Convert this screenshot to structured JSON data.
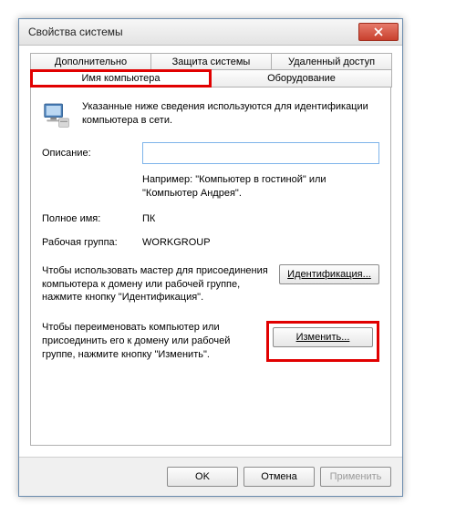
{
  "title": "Свойства системы",
  "tabs_top": [
    "Дополнительно",
    "Защита системы",
    "Удаленный доступ"
  ],
  "tabs_bottom": [
    "Имя компьютера",
    "Оборудование"
  ],
  "active_tab": "Имя компьютера",
  "intro": "Указанные ниже сведения используются для идентификации компьютера в сети.",
  "description": {
    "label": "Описание:",
    "value": ""
  },
  "example": "Например: \"Компьютер в гостиной\" или \"Компьютер Андрея\".",
  "fullname": {
    "label": "Полное имя:",
    "value": "ПК"
  },
  "workgroup": {
    "label": "Рабочая группа:",
    "value": "WORKGROUP"
  },
  "ident_block": {
    "text": "Чтобы использовать мастер для присоединения компьютера к домену или рабочей группе, нажмите кнопку \"Идентификация\".",
    "button": "Идентификация..."
  },
  "change_block": {
    "text": "Чтобы переименовать компьютер или присоединить его к домену или рабочей группе, нажмите кнопку \"Изменить\".",
    "button": "Изменить..."
  },
  "buttons": {
    "ok": "OK",
    "cancel": "Отмена",
    "apply": "Применить"
  }
}
